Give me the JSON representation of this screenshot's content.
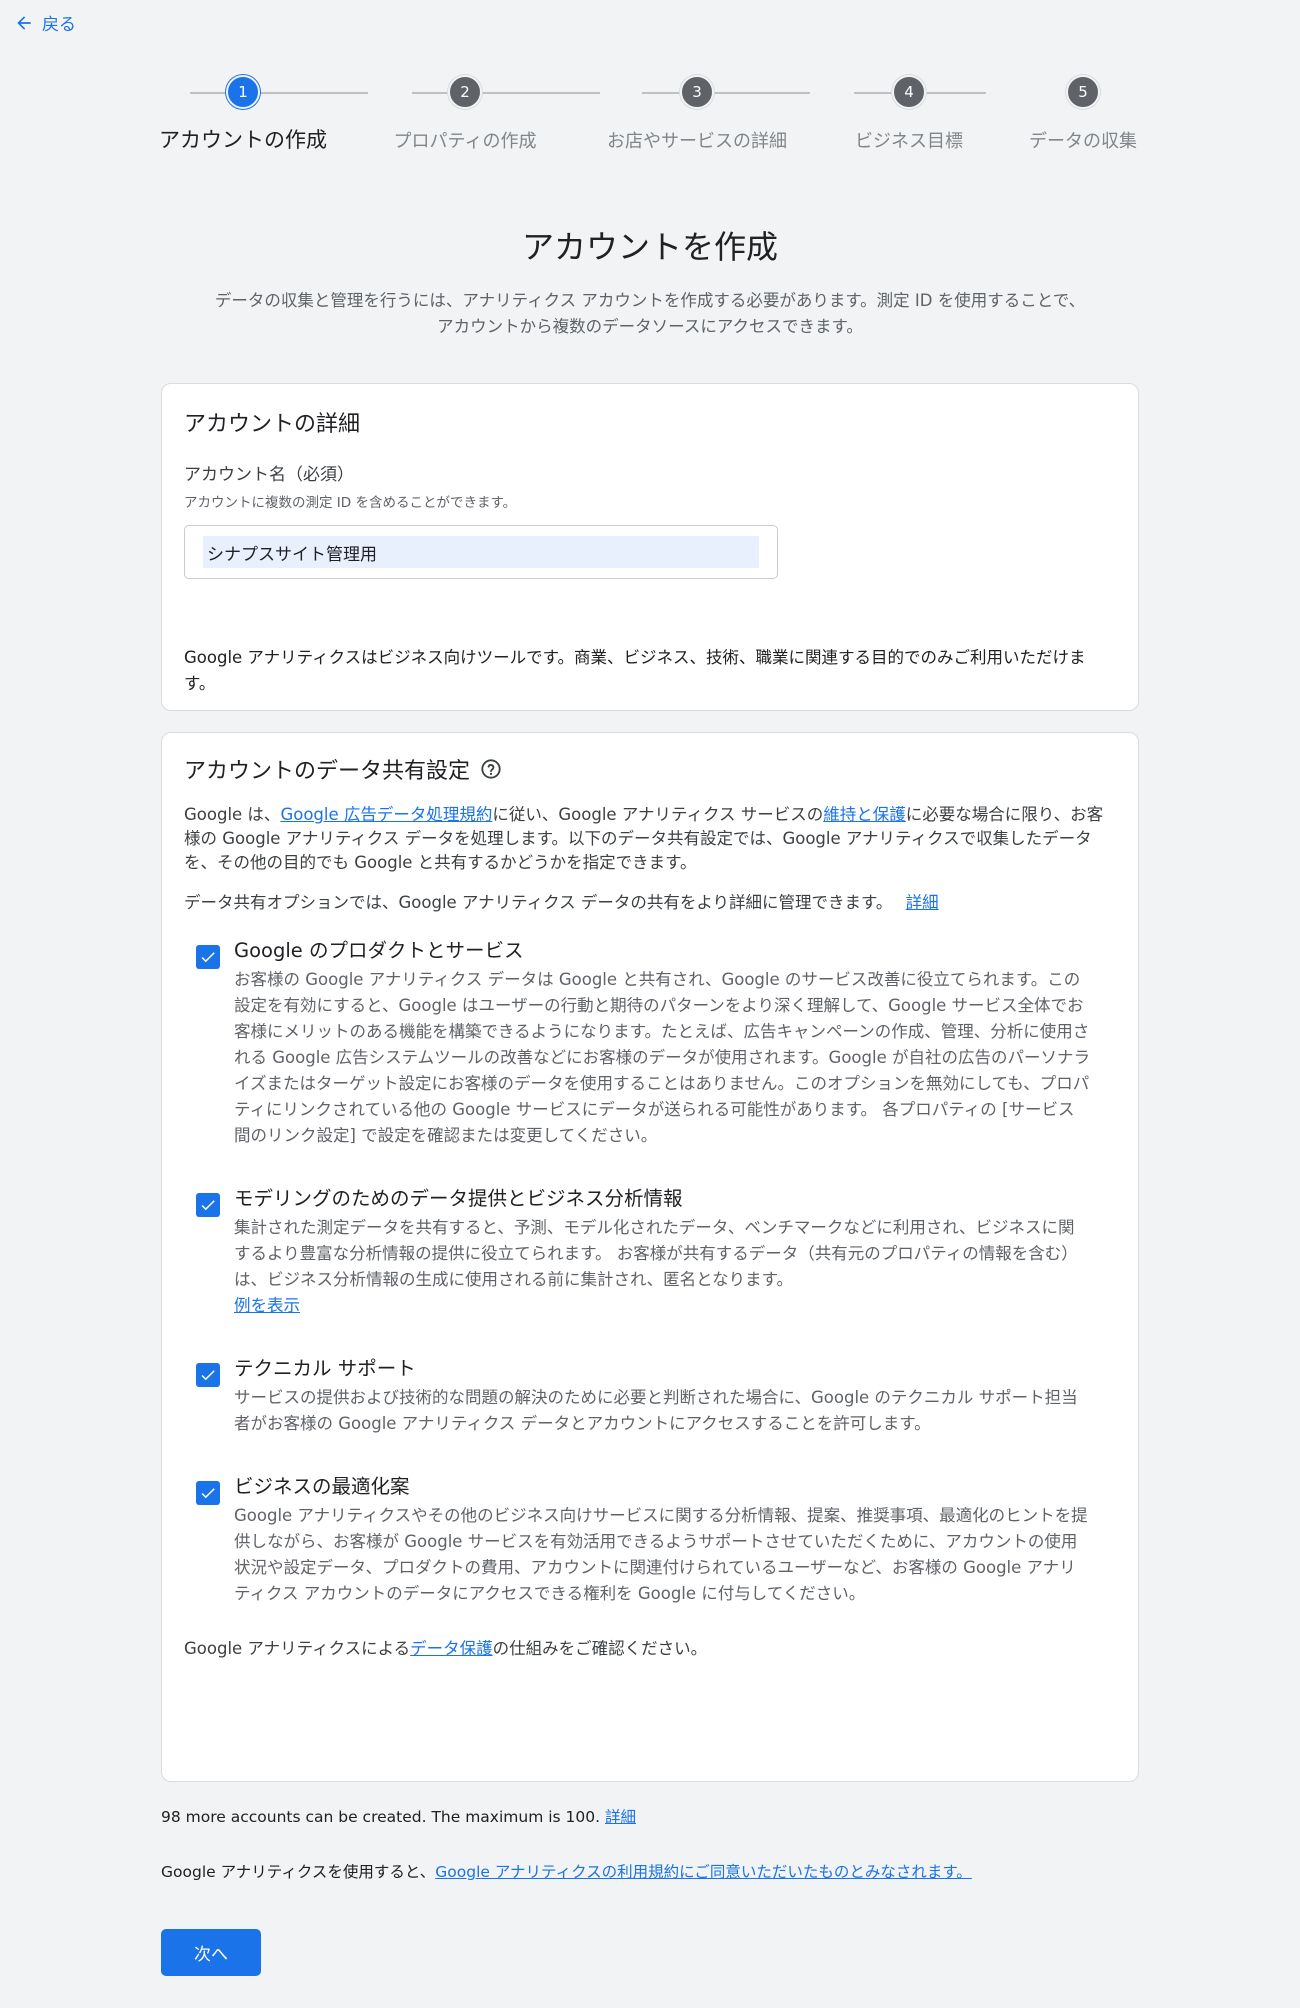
{
  "back": {
    "label": "戻る"
  },
  "stepper": {
    "steps": [
      {
        "number": "1",
        "label": "アカウントの作成"
      },
      {
        "number": "2",
        "label": "プロパティの作成"
      },
      {
        "number": "3",
        "label": "お店やサービスの詳細"
      },
      {
        "number": "4",
        "label": "ビジネス目標"
      },
      {
        "number": "5",
        "label": "データの収集"
      }
    ],
    "active_index": 0
  },
  "header": {
    "title": "アカウントを作成",
    "description_line1": "データの収集と管理を行うには、アナリティクス アカウントを作成する必要があります。測定 ID を使用することで、",
    "description_line2": "アカウントから複数のデータソースにアクセスできます。"
  },
  "account_details": {
    "title": "アカウントの詳細",
    "name_label": "アカウント名（必須）",
    "name_hint": "アカウントに複数の測定 ID を含めることができます。",
    "name_value": "シナプスサイト管理用",
    "business_note": "Google アナリティクスはビジネス向けツールです。商業、ビジネス、技術、職業に関連する目的でのみご利用いただけます。"
  },
  "data_sharing": {
    "title": "アカウントのデータ共有設定",
    "intro_prefix": "Google は、",
    "intro_link1": "Google 広告データ処理規約",
    "intro_middle": "に従い、Google アナリティクス サービスの",
    "intro_link2": "維持と保護",
    "intro_suffix": "に必要な場合に限り、お客様の Google アナリティクス データを処理します。以下のデータ共有設定では、Google アナリティクスで収集したデータを、その他の目的でも Google と共有するかどうかを指定できます。",
    "options_note": "データ共有オプションでは、Google アナリティクス データの共有をより詳細に管理できます。",
    "options_note_link": "詳細",
    "options": [
      {
        "title": "Google のプロダクトとサービス",
        "description": "お客様の Google アナリティクス データは Google と共有され、Google のサービス改善に役立てられます。この設定を有効にすると、Google はユーザーの行動と期待のパターンをより深く理解して、Google サービス全体でお客様にメリットのある機能を構築できるようになります。たとえば、広告キャンペーンの作成、管理、分析に使用される Google 広告システムツールの改善などにお客様のデータが使用されます。Google が自社の広告のパーソナライズまたはターゲット設定にお客様のデータを使用することはありません。このオプションを無効にしても、プロパティにリンクされている他の Google サービスにデータが送られる可能性があります。 各プロパティの [サービス間のリンク設定] で設定を確認または変更してください。",
        "link": "",
        "checked": true
      },
      {
        "title": "モデリングのためのデータ提供とビジネス分析情報",
        "description": "集計された測定データを共有すると、予測、モデル化されたデータ、ベンチマークなどに利用され、ビジネスに関するより豊富な分析情報の提供に役立てられます。 お客様が共有するデータ（共有元のプロパティの情報を含む）は、ビジネス分析情報の生成に使用される前に集計され、匿名となります。",
        "link": "例を表示",
        "checked": true
      },
      {
        "title": "テクニカル サポート",
        "description": "サービスの提供および技術的な問題の解決のために必要と判断された場合に、Google のテクニカル サポート担当者がお客様の Google アナリティクス データとアカウントにアクセスすることを許可します。",
        "link": "",
        "checked": true
      },
      {
        "title": "ビジネスの最適化案",
        "description": "Google アナリティクスやその他のビジネス向けサービスに関する分析情報、提案、推奨事項、最適化のヒントを提供しながら、お客様が Google サービスを有効活用できるようサポートさせていただくために、アカウントの使用状況や設定データ、プロダクトの費用、アカウントに関連付けられているユーザーなど、お客様の Google アナリティクス アカウントのデータにアクセスできる権利を Google に付与してください。",
        "link": "",
        "checked": true
      }
    ],
    "footer_prefix": "Google アナリティクスによる",
    "footer_link": "データ保護",
    "footer_suffix": "の仕組みをご確認ください。"
  },
  "limits": {
    "text": "98 more accounts can be created. The maximum is 100. ",
    "link": "詳細"
  },
  "terms": {
    "prefix": "Google アナリティクスを使用すると、",
    "link": "Google アナリティクスの利用規約にご同意いただいたものとみなされます。"
  },
  "next_button": {
    "label": "次へ"
  },
  "colors": {
    "accent": "#1a73e8",
    "inactive_step": "#5f6368",
    "background": "#f1f3f4"
  }
}
